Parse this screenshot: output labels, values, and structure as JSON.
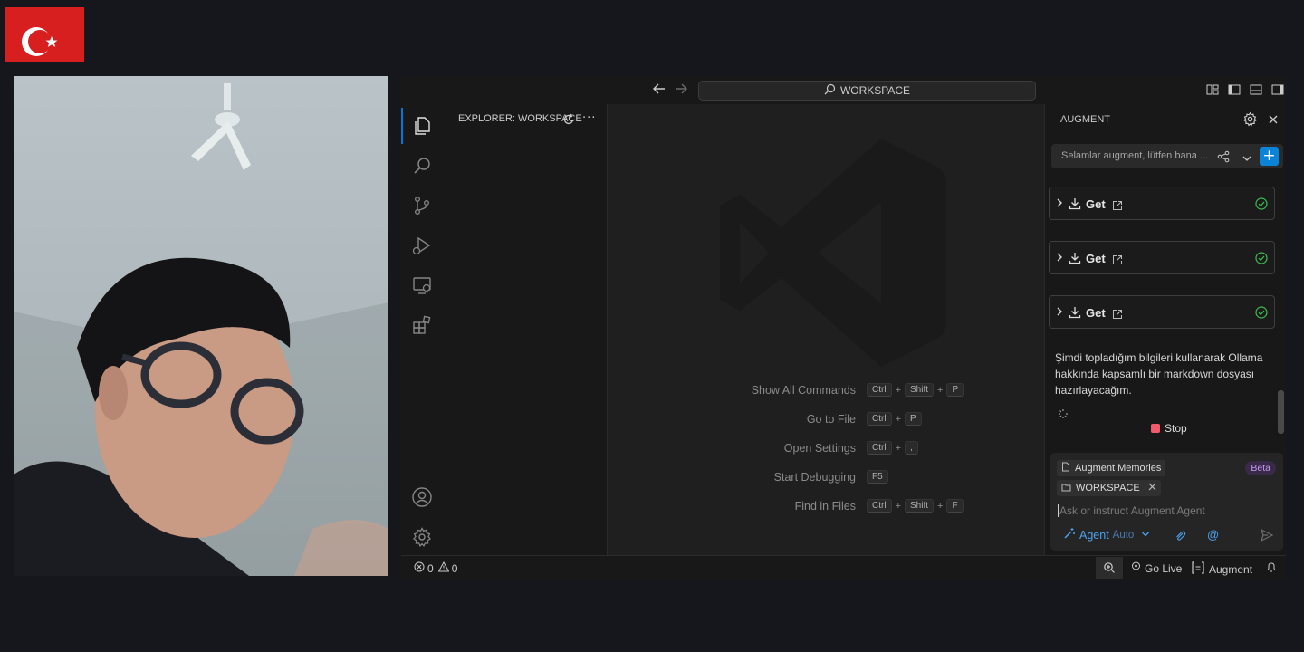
{
  "titlebar": {
    "back_icon": "arrow-left-icon",
    "forward_icon": "arrow-right-icon",
    "search_text": "WORKSPACE"
  },
  "activity_bar": {
    "items": [
      "explorer-icon",
      "search-icon",
      "source-control-icon",
      "run-debug-icon",
      "remote-explorer-icon",
      "extensions-icon"
    ],
    "bottom": [
      "account-icon",
      "gear-icon"
    ]
  },
  "sidebar": {
    "title": "EXPLORER: WORKSPACE"
  },
  "editor": {
    "shortcuts": [
      {
        "label": "Show All Commands",
        "keys": [
          "Ctrl",
          "Shift",
          "P"
        ]
      },
      {
        "label": "Go to File",
        "keys": [
          "Ctrl",
          "P"
        ]
      },
      {
        "label": "Open Settings",
        "keys": [
          "Ctrl",
          ","
        ]
      },
      {
        "label": "Start Debugging",
        "keys": [
          "F5"
        ]
      },
      {
        "label": "Find in Files",
        "keys": [
          "Ctrl",
          "Shift",
          "F"
        ]
      }
    ]
  },
  "augment": {
    "title": "AUGMENT",
    "thread_title": "Selamlar augment, lütfen bana ...",
    "tool_cards": [
      {
        "label": "Get",
        "status": "success"
      },
      {
        "label": "Get",
        "status": "success"
      },
      {
        "label": "Get",
        "status": "success"
      }
    ],
    "message": "Şimdi topladığım bilgileri kullanarak Ollama hakkında kapsamlı bir markdown dosyası hazırlayacağım.",
    "stop_label": "Stop",
    "memories_label": "Augment Memories",
    "beta_label": "Beta",
    "context_chip": "WORKSPACE",
    "input_placeholder": "Ask or instruct Augment Agent",
    "mode_label": "Agent",
    "mode_sub": "Auto",
    "mention_symbol": "@"
  },
  "statusbar": {
    "errors": "0",
    "warnings": "0",
    "go_live": "Go Live",
    "augment": "Augment"
  },
  "colors": {
    "accent": "#0078d4",
    "plus_button": "#0a84d8",
    "success": "#3fb950",
    "stop": "#f05a6e",
    "beta": "#c59bf0",
    "agent_mode": "#4ea3f1",
    "flag_red": "#d81f1f"
  }
}
